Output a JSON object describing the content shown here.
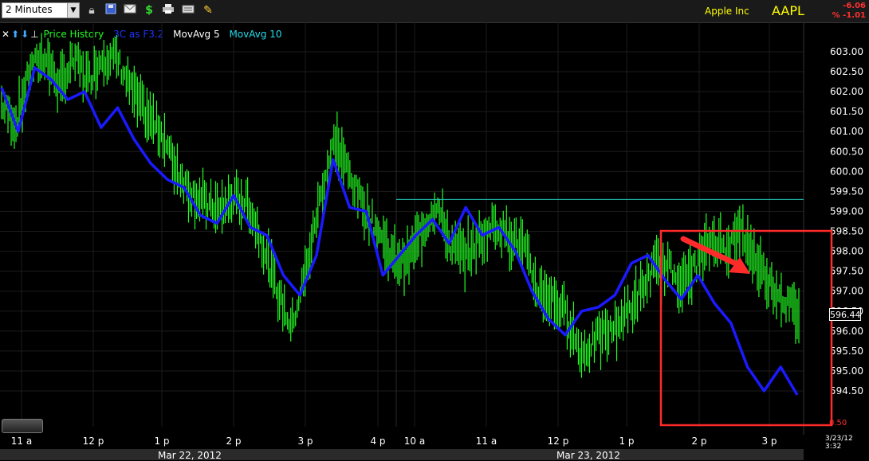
{
  "toolbar": {
    "timeframe": "2 Minutes",
    "icons": [
      "lock-icon",
      "save-icon",
      "email-icon",
      "dollar-icon",
      "print-icon",
      "keyboard-icon",
      "pencil-icon"
    ]
  },
  "header": {
    "company": "Apple Inc",
    "symbol": "AAPL",
    "change_abs": "-6.06",
    "change_pct": "% -1.01"
  },
  "legend": {
    "price": "Price History",
    "indicator": "3C as F3.2",
    "ma5": "MovAvg 5",
    "ma10": "MovAvg 10"
  },
  "footer": {
    "date1": "Mar 22, 2012",
    "date2": "Mar 23, 2012",
    "timestamp": "3/23/12 3:32",
    "last_price": "596.44",
    "scale_value": "0.50"
  },
  "colors": {
    "price": "#22ff22",
    "indicator": "#1a1aff",
    "ma10_line": "#22ccbb",
    "highlight_box": "#ff2a2a",
    "arrow": "#ff2a2a"
  },
  "chart_data": {
    "type": "line",
    "yaxis_ticks": [
      "603.00",
      "602.50",
      "602.00",
      "601.50",
      "601.00",
      "600.50",
      "600.00",
      "599.50",
      "599.00",
      "598.50",
      "598.00",
      "597.50",
      "597.00",
      "596.50",
      "596.00",
      "595.50",
      "595.00",
      "594.50"
    ],
    "ylim": [
      594.0,
      603.5
    ],
    "xaxis_ticks": [
      "11 a",
      "12 p",
      "1 p",
      "2 p",
      "3 p",
      "4 p",
      "10 a",
      "11 a",
      "12 p",
      "1 p",
      "2 p",
      "3 p"
    ],
    "grid": true,
    "series": [
      {
        "name": "Price History",
        "values": [
          601.7,
          601.2,
          602.6,
          602.9,
          602.1,
          602.8,
          602.3,
          602.9,
          602.8,
          602.0,
          601.4,
          601.0,
          600.1,
          599.5,
          599.2,
          599.0,
          599.3,
          599.2,
          598.2,
          597.0,
          596.1,
          597.5,
          599.4,
          600.8,
          599.9,
          599.1,
          598.5,
          597.8,
          597.8,
          598.5,
          599.2,
          598.1,
          597.9,
          598.3,
          598.7,
          598.4,
          598.1,
          597.0,
          596.8,
          596.4,
          595.4,
          595.8,
          596.0,
          596.4,
          596.9,
          597.6,
          597.6,
          597.2,
          597.7,
          598.3,
          598.1,
          598.5,
          597.8,
          597.2,
          596.8,
          596.4
        ]
      },
      {
        "name": "3C as F3.2",
        "values": [
          602.1,
          601.0,
          602.6,
          602.3,
          601.8,
          602.0,
          601.1,
          601.6,
          600.8,
          600.2,
          599.8,
          599.6,
          598.9,
          598.7,
          599.4,
          598.6,
          598.4,
          597.4,
          596.9,
          597.9,
          600.3,
          599.1,
          599.0,
          597.4,
          597.9,
          598.4,
          598.8,
          598.2,
          599.1,
          598.4,
          598.6,
          598.0,
          597.0,
          596.3,
          595.9,
          596.5,
          596.6,
          596.9,
          597.7,
          597.9,
          597.3,
          596.8,
          597.4,
          596.7,
          596.2,
          595.1,
          594.5,
          595.1,
          594.4
        ]
      },
      {
        "name": "MovAvg 10",
        "values": [
          599.3,
          599.3
        ]
      }
    ]
  }
}
